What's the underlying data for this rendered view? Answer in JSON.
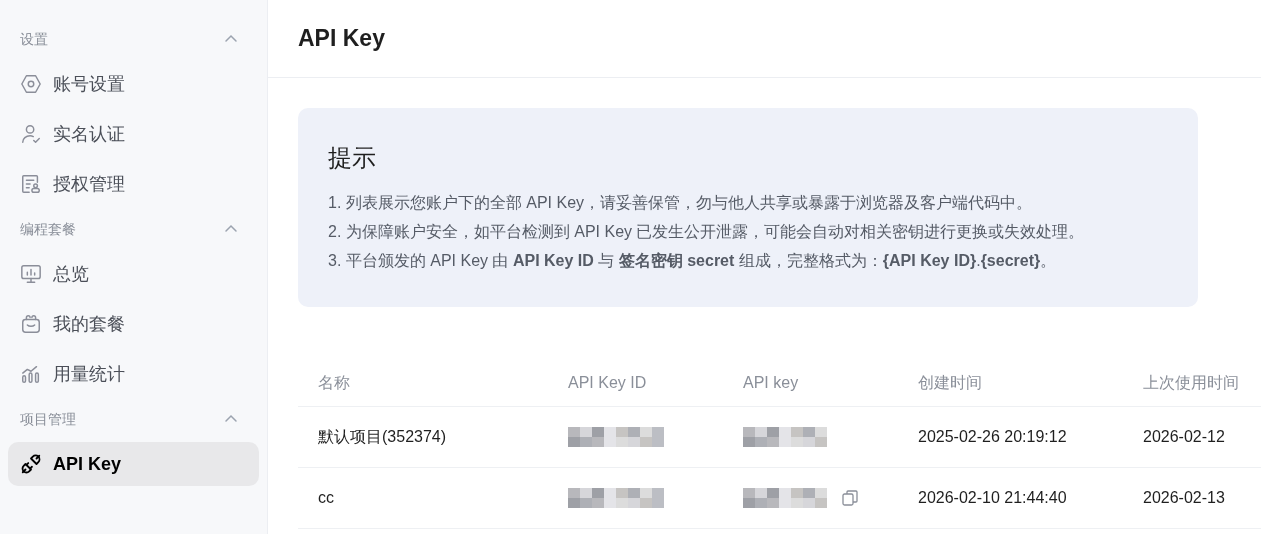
{
  "sidebar": {
    "groups": [
      {
        "title": "设置",
        "expanded": true,
        "items": [
          {
            "label": "账号设置",
            "selected": false
          },
          {
            "label": "实名认证",
            "selected": false
          },
          {
            "label": "授权管理",
            "selected": false
          }
        ]
      },
      {
        "title": "编程套餐",
        "expanded": true,
        "items": [
          {
            "label": "总览",
            "selected": false
          },
          {
            "label": "我的套餐",
            "selected": false
          },
          {
            "label": "用量统计",
            "selected": false
          }
        ]
      },
      {
        "title": "项目管理",
        "expanded": true,
        "items": [
          {
            "label": "API Key",
            "selected": true
          }
        ]
      }
    ]
  },
  "page": {
    "title": "API Key"
  },
  "notice": {
    "title": "提示",
    "lines": [
      "1. 列表展示您账户下的全部 API Key，请妥善保管，勿与他人共享或暴露于浏览器及客户端代码中。",
      "2. 为保障账户安全，如平台检测到 API Key 已发生公开泄露，可能会自动对相关密钥进行更换或失效处理。",
      "3. 平台颁发的 API Key 由 **API Key ID** 与 **签名密钥 secret** 组成，完整格式为：**{API Key ID}**.**{secret}**。"
    ]
  },
  "table": {
    "columns": [
      "名称",
      "API Key ID",
      "API key",
      "创建时间",
      "上次使用时间"
    ],
    "rows": [
      {
        "name": "默认项目(352374)",
        "key_id_masked": true,
        "key_masked": true,
        "copy_icon": false,
        "created": "2025-02-26 20:19:12",
        "last_used": "2026-02-12"
      },
      {
        "name": "cc",
        "key_id_masked": true,
        "key_masked": true,
        "copy_icon": true,
        "created": "2026-02-10 21:44:40",
        "last_used": "2026-02-13"
      }
    ]
  }
}
